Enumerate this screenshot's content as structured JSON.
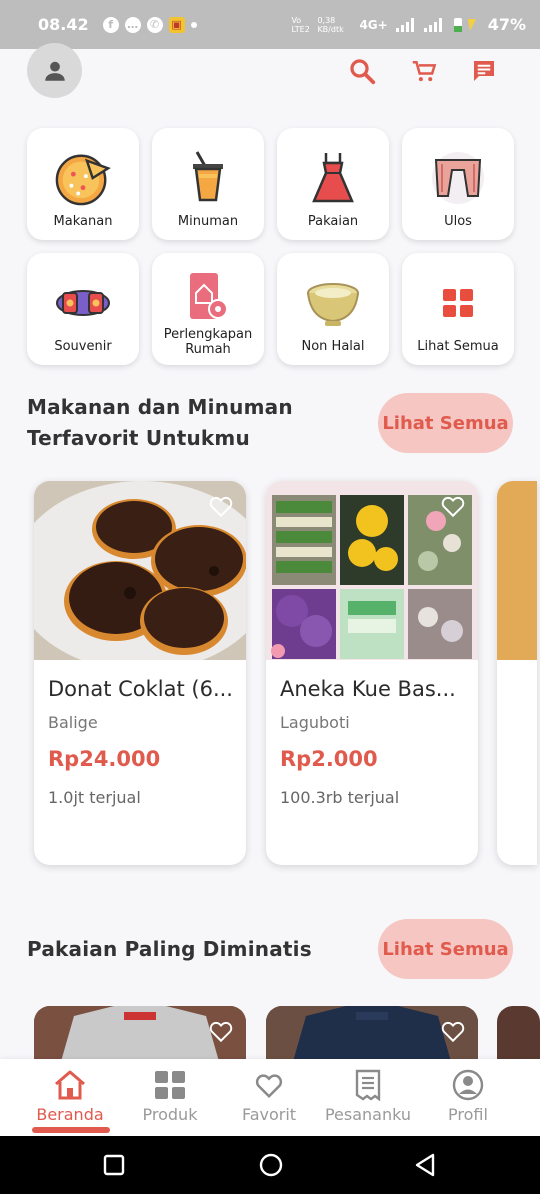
{
  "status_bar": {
    "time": "08.42",
    "network_label": "Vo LTE2",
    "speed": "0,38 KB/dtk",
    "network_type": "4G+",
    "battery": "47%"
  },
  "header": {
    "avatar_icon": "person-icon",
    "actions": [
      "search-icon",
      "cart-icon",
      "message-icon"
    ]
  },
  "categories": [
    {
      "label": "Makanan",
      "icon": "pizza-icon"
    },
    {
      "label": "Minuman",
      "icon": "drink-icon"
    },
    {
      "label": "Pakaian",
      "icon": "dress-icon"
    },
    {
      "label": "Ulos",
      "icon": "ulos-icon"
    },
    {
      "label": "Souvenir",
      "icon": "souvenir-icon"
    },
    {
      "label": "Perlengkapan Rumah",
      "icon": "home-tools-icon"
    },
    {
      "label": "Non Halal",
      "icon": "bowl-icon"
    },
    {
      "label": "Lihat Semua",
      "icon": "grid-icon"
    }
  ],
  "section_favorites": {
    "title_line1": "Makanan dan Minuman",
    "title_line2": "Terfavorit Untukmu",
    "see_all": "Lihat Semua",
    "products": [
      {
        "name": "Donat Coklat (6...",
        "location": "Balige",
        "price": "Rp24.000",
        "sold": "1.0jt terjual"
      },
      {
        "name": "Aneka Kue Bas...",
        "location": "Laguboti",
        "price": "Rp2.000",
        "sold": "100.3rb terjual"
      }
    ]
  },
  "section_clothing": {
    "title": "Pakaian Paling Diminatis",
    "see_all": "Lihat Semua"
  },
  "bottom_nav": [
    {
      "label": "Beranda",
      "icon": "home-icon",
      "active": true
    },
    {
      "label": "Produk",
      "icon": "grid-icon",
      "active": false
    },
    {
      "label": "Favorit",
      "icon": "heart-icon",
      "active": false
    },
    {
      "label": "Pesananku",
      "icon": "receipt-icon",
      "active": false
    },
    {
      "label": "Profil",
      "icon": "profile-icon",
      "active": false
    }
  ],
  "colors": {
    "accent": "#e05a4d",
    "accent_soft": "#f5c6c2",
    "muted": "#9a9a9a"
  }
}
